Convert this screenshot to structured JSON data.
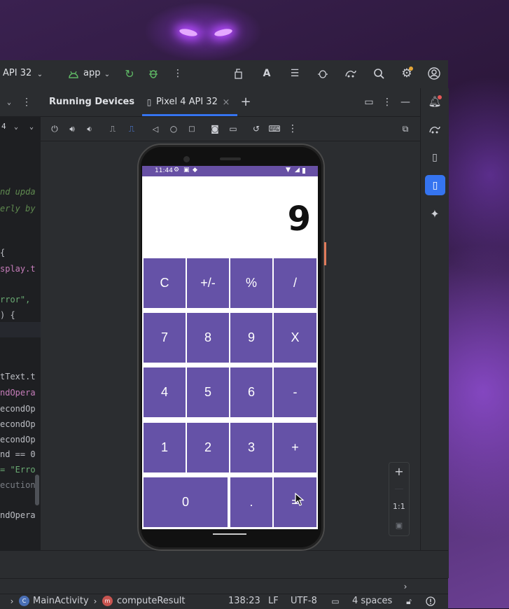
{
  "toolbar": {
    "device_label": "API 32",
    "run_config": "app"
  },
  "editor": {
    "partial_tab": "4",
    "lines": [
      {
        "text": "nd upda",
        "color": "#5f8a4f",
        "italic": true
      },
      {
        "text": "erly by",
        "color": "#5f8a4f",
        "italic": true
      },
      {
        "text": "{",
        "color": "#bcbec4"
      },
      {
        "text": "splay.t",
        "color": "#c77dbb"
      },
      {
        "text": "rror\", ",
        "color": "#6aab73"
      },
      {
        "text": ") {",
        "color": "#bcbec4"
      },
      {
        "text": "tText.t",
        "color": "#bcbec4"
      },
      {
        "text": "ndOpera",
        "color": "#c77dbb"
      },
      {
        "text": "econdOp",
        "color": "#bcbec4"
      },
      {
        "text": "econdOp",
        "color": "#bcbec4"
      },
      {
        "text": "econdOp",
        "color": "#bcbec4"
      },
      {
        "text": "nd == 0",
        "color": "#bcbec4"
      },
      {
        "text": "= \"Erro",
        "color": "#6aab73"
      },
      {
        "text": "ecution",
        "color": "#7a7e85"
      },
      {
        "text": "ndOpera",
        "color": "#bcbec4"
      }
    ]
  },
  "running_devices": {
    "panel_title": "Running Devices",
    "device_tab": "Pixel 4 API 32"
  },
  "phone": {
    "time": "11:44",
    "display_value": "9",
    "buttons": [
      "C",
      "+/-",
      "%",
      "/",
      "7",
      "8",
      "9",
      "X",
      "4",
      "5",
      "6",
      "-",
      "1",
      "2",
      "3",
      "+",
      "0",
      ".",
      "="
    ]
  },
  "zoom": {
    "reset_label": "1:1"
  },
  "statusbar": {
    "class_name": "MainActivity",
    "method_name": "computeResult",
    "position": "138:23",
    "line_ending": "LF",
    "encoding": "UTF-8",
    "indent": "4 spaces"
  },
  "colors": {
    "accent": "#6552a7",
    "ide_bg": "#2b2d30",
    "tab_underline": "#3574f0"
  }
}
